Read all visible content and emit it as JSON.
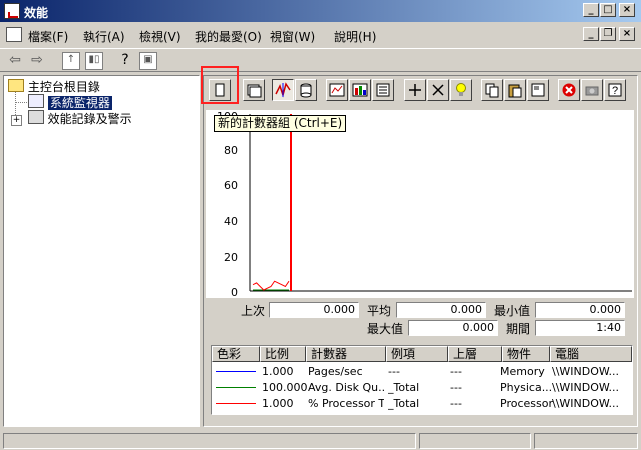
{
  "window": {
    "title": "效能"
  },
  "menu": [
    "檔案(F)",
    "執行(A)",
    "檢視(V)",
    "我的最愛(O)",
    "視窗(W)",
    "說明(H)"
  ],
  "tree": {
    "root": "主控台根目錄",
    "monitor": "系統監視器",
    "logs": "效能記錄及警示"
  },
  "tooltip": "新的計數器組 (Ctrl+E)",
  "chart_data": {
    "type": "line",
    "yticks": [
      "100",
      "80",
      "60",
      "40",
      "20",
      "0"
    ],
    "ylim": [
      0,
      100
    ],
    "series": [
      {
        "color": "#0000ff",
        "values": [
          0,
          0,
          0,
          0,
          0,
          0,
          0,
          0,
          0,
          0,
          0
        ]
      },
      {
        "color": "#008000",
        "values": [
          0,
          0,
          0,
          0,
          0,
          0,
          0,
          0,
          0,
          0,
          0
        ]
      },
      {
        "color": "#ff0000",
        "values": [
          3,
          4,
          2,
          0,
          1,
          2,
          5,
          4,
          3,
          2,
          5
        ]
      }
    ]
  },
  "stats": {
    "last_label": "上次",
    "last_value": "0.000",
    "avg_label": "平均",
    "avg_value": "0.000",
    "min_label": "最小值",
    "min_value": "0.000",
    "max_label": "最大值",
    "max_value": "0.000",
    "dur_label": "期間",
    "dur_value": "1:40"
  },
  "legend": {
    "headers": [
      "色彩",
      "比例",
      "計數器",
      "例項",
      "上層",
      "物件",
      "電腦"
    ],
    "rows": [
      {
        "color": "#0000ff",
        "scale": "1.000",
        "counter": "Pages/sec",
        "instance": "---",
        "parent": "---",
        "object": "Memory",
        "computer": "\\\\WINDOW..."
      },
      {
        "color": "#008000",
        "scale": "100.000",
        "counter": "Avg. Disk Qu...",
        "instance": "_Total",
        "parent": "---",
        "object": "Physica...",
        "computer": "\\\\WINDOW..."
      },
      {
        "color": "#ff0000",
        "scale": "1.000",
        "counter": "% Processor T...",
        "instance": "_Total",
        "parent": "---",
        "object": "Processor",
        "computer": "\\\\WINDOW..."
      }
    ]
  }
}
